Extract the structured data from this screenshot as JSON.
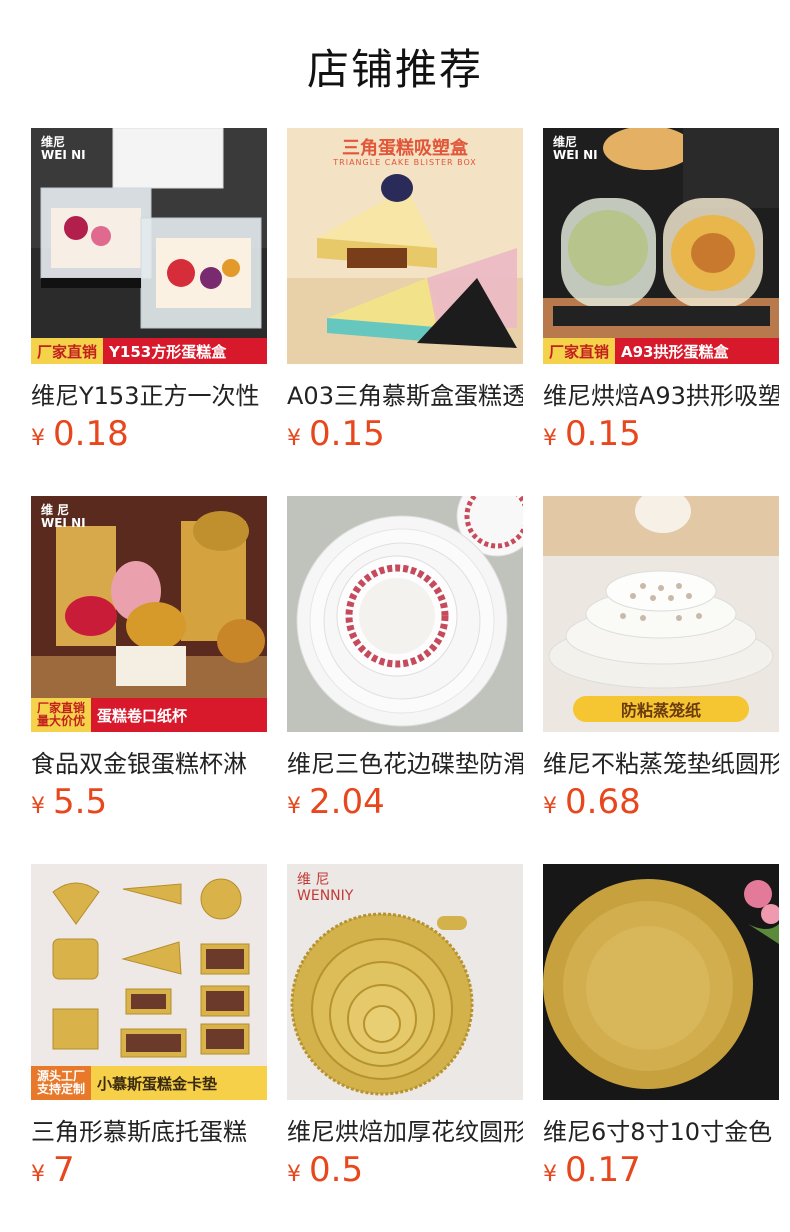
{
  "section": {
    "title": "店铺推荐"
  },
  "colors": {
    "price": "#e8471e",
    "banner_red": "#d8192c",
    "banner_yellow": "#f4d34a"
  },
  "products": [
    {
      "name": "维尼Y153正方一次性",
      "currency": "¥",
      "price": "0.18",
      "image": {
        "brand": "维尼\nWEI NI",
        "banner_left": "厂家直销",
        "banner_right": "Y153方形蛋糕盒"
      }
    },
    {
      "name": "A03三角慕斯盒蛋糕透",
      "currency": "¥",
      "price": "0.15",
      "image": {
        "caption": "三角蛋糕吸塑盒",
        "caption_sub": "TRIANGLE CAKE BLISTER BOX"
      }
    },
    {
      "name": "维尼烘焙A93拱形吸塑",
      "currency": "¥",
      "price": "0.15",
      "image": {
        "brand": "维尼\nWEI NI",
        "banner_left": "厂家直销",
        "banner_right": "A93拱形蛋糕盒"
      }
    },
    {
      "name": "食品双金银蛋糕杯淋",
      "currency": "¥",
      "price": "5.5",
      "image": {
        "brand": "维 尼\nWEI NI",
        "banner_left": "厂家直销\n量大价优",
        "banner_right": "蛋糕卷口纸杯"
      }
    },
    {
      "name": "维尼三色花边碟垫防滑",
      "currency": "¥",
      "price": "2.04",
      "image": {}
    },
    {
      "name": "维尼不粘蒸笼垫纸圆形",
      "currency": "¥",
      "price": "0.68",
      "image": {
        "pill": "防粘蒸笼纸"
      }
    },
    {
      "name": "三角形慕斯底托蛋糕",
      "currency": "¥",
      "price": "7",
      "image": {
        "banner_left": "源头工厂\n支持定制",
        "banner_right": "小慕斯蛋糕金卡垫"
      }
    },
    {
      "name": "维尼烘焙加厚花纹圆形",
      "currency": "¥",
      "price": "0.5",
      "image": {
        "brand": "维 尼\nWENNIY"
      }
    },
    {
      "name": "维尼6寸8寸10寸金色",
      "currency": "¥",
      "price": "0.17",
      "image": {}
    }
  ]
}
